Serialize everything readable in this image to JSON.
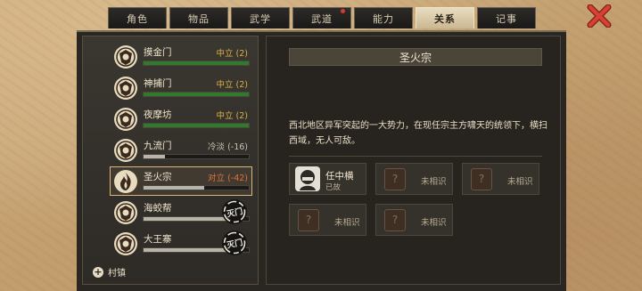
{
  "tabs": [
    {
      "label": "角色",
      "active": false,
      "badge": false
    },
    {
      "label": "物品",
      "active": false,
      "badge": false
    },
    {
      "label": "武学",
      "active": false,
      "badge": false
    },
    {
      "label": "武道",
      "active": false,
      "badge": true
    },
    {
      "label": "能力",
      "active": false,
      "badge": false
    },
    {
      "label": "关系",
      "active": true,
      "badge": false
    },
    {
      "label": "记事",
      "active": false,
      "badge": false
    }
  ],
  "factions": [
    {
      "name": "摸金门",
      "relation": "中立 (2)",
      "relation_color": "#d9b14a",
      "bar_color": "#2f7a2b",
      "bar_fraction": 1.0,
      "stamp": null,
      "icon": "faction-emblem-icon"
    },
    {
      "name": "神捕门",
      "relation": "中立 (2)",
      "relation_color": "#d9b14a",
      "bar_color": "#2f7a2b",
      "bar_fraction": 1.0,
      "stamp": null,
      "icon": "faction-emblem-icon"
    },
    {
      "name": "夜摩坊",
      "relation": "中立 (2)",
      "relation_color": "#d9b14a",
      "bar_color": "#2f7a2b",
      "bar_fraction": 1.0,
      "stamp": null,
      "icon": "faction-emblem-icon"
    },
    {
      "name": "九流门",
      "relation": "冷淡 (-16)",
      "relation_color": "#c9c1b0",
      "bar_color": "#b9b4aa",
      "bar_fraction": 0.2,
      "stamp": null,
      "icon": "faction-emblem-icon"
    },
    {
      "name": "圣火宗",
      "relation": "对立 (-42)",
      "relation_color": "#e0703a",
      "bar_color": "#b9b4aa",
      "bar_fraction": 0.58,
      "stamp": null,
      "icon": "flame-emblem-icon",
      "selected": true
    },
    {
      "name": "海蛟帮",
      "relation": "",
      "relation_color": "#c9c1b0",
      "bar_color": "#b9b4aa",
      "bar_fraction": 0.82,
      "stamp": "灭门",
      "icon": "faction-emblem-icon"
    },
    {
      "name": "大王寨",
      "relation": "",
      "relation_color": "#c9c1b0",
      "bar_color": "#b9b4aa",
      "bar_fraction": 0.82,
      "stamp": "灭门",
      "icon": "faction-emblem-icon"
    }
  ],
  "town_toggle": "村镇",
  "detail": {
    "title": "圣火宗",
    "description": "西北地区异军突起的一大势力，在现任宗主方啸天的统领下，横扫西域，无人可敌。",
    "members": [
      {
        "name": "任中横",
        "status": "已故",
        "known": true
      },
      {
        "name": "未相识",
        "status": "",
        "known": false
      },
      {
        "name": "未相识",
        "status": "",
        "known": false
      },
      {
        "name": "未相识",
        "status": "",
        "known": false
      },
      {
        "name": "未相识",
        "status": "",
        "known": false
      }
    ]
  },
  "colors": {
    "accent": "#d9b77a",
    "close": "#c8372b"
  }
}
